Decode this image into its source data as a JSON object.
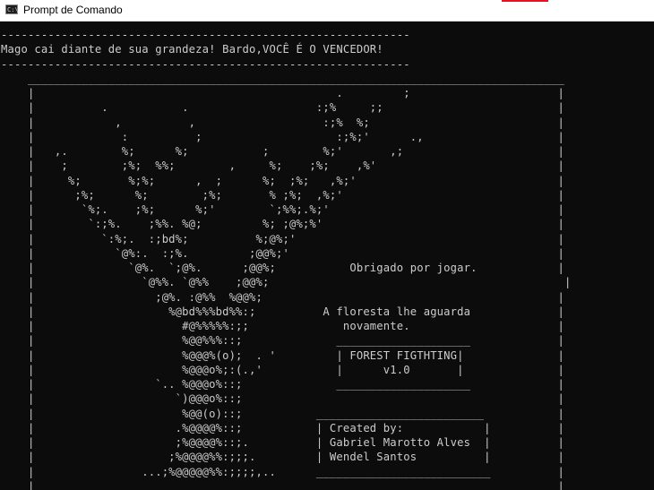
{
  "window": {
    "title": "Prompt de Comando",
    "icon_name": "cmd-icon",
    "icon_glyph": "C:\\",
    "background": "#0c0c0c",
    "text_color": "#cccccc",
    "titlebar_color": "#ffffff"
  },
  "console_lines": [
    "-------------------------------------------------------------",
    "Mago cai diante de sua grandeza! Bardo,VOCÊ É O VENCEDOR!",
    "-------------------------------------------------------------",
    "    ________________________________________________________________________________",
    "    |                                             .         ;                      |",
    "    |          .           .                   :;%     ;;                          |",
    "    |            ,          ,                   :;%  %;                            |",
    "    |             :          ;                    :;%;'      .,                    |",
    "    |   ,.        %;      %;           ;        %;'       ,;                       |",
    "    |    ;        ;%;  %%;        ,     %;    ;%;    ,%'                           |",
    "    |     %;       %;%;      ,  ;      %;  ;%;   ,%;'                              |",
    "    |      ;%;      %;        ;%;       % ;%;  ,%;'                                |",
    "    |       `%;.    ;%;      %;'        `;%%;.%;'                                  |",
    "    |        `:;%.    ;%%. %@;         %; ;@%;%'                                   |",
    "    |          `:%;.  :;bd%;          %;@%;'                                       |",
    "    |            `@%:.  :;%.         ;@@%;'                                        |",
    "    |              `@%.  `;@%.      ;@@%;           Obrigado por jogar.            |",
    "    |                `@%%. `@%%    ;@@%;                                            |",
    "    |                  ;@%. :@%%  %@@%;                                            |",
    "    |                    %@bd%%%bd%%:;          A floresta lhe aguarda             |",
    "    |                      #@%%%%%:;;              novamente.                      |",
    "    |                      %@@%%%::;              ____________________             |",
    "    |                      %@@@%(o);  . '         | FOREST FIGTHTING|              |",
    "    |                      %@@@o%;:(.,'           |      v1.0       |              |",
    "    |                  `.. %@@@o%::;              ____________________             |",
    "    |                     `)@@@o%::;                                               |",
    "    |                      %@@(o)::;           _________________________           |",
    "    |                     .%@@@@%::;           | Created by:            |          |",
    "    |                     ;%@@@@%::;.          | Gabriel Marotto Alves  |          |",
    "    |                    ;%@@@@%%:;;;.         | Wendel Santos          |          |",
    "    |                ...;%@@@@@%%:;;;;,..      __________________________          |",
    "    |______________________________________________________________________________|"
  ]
}
